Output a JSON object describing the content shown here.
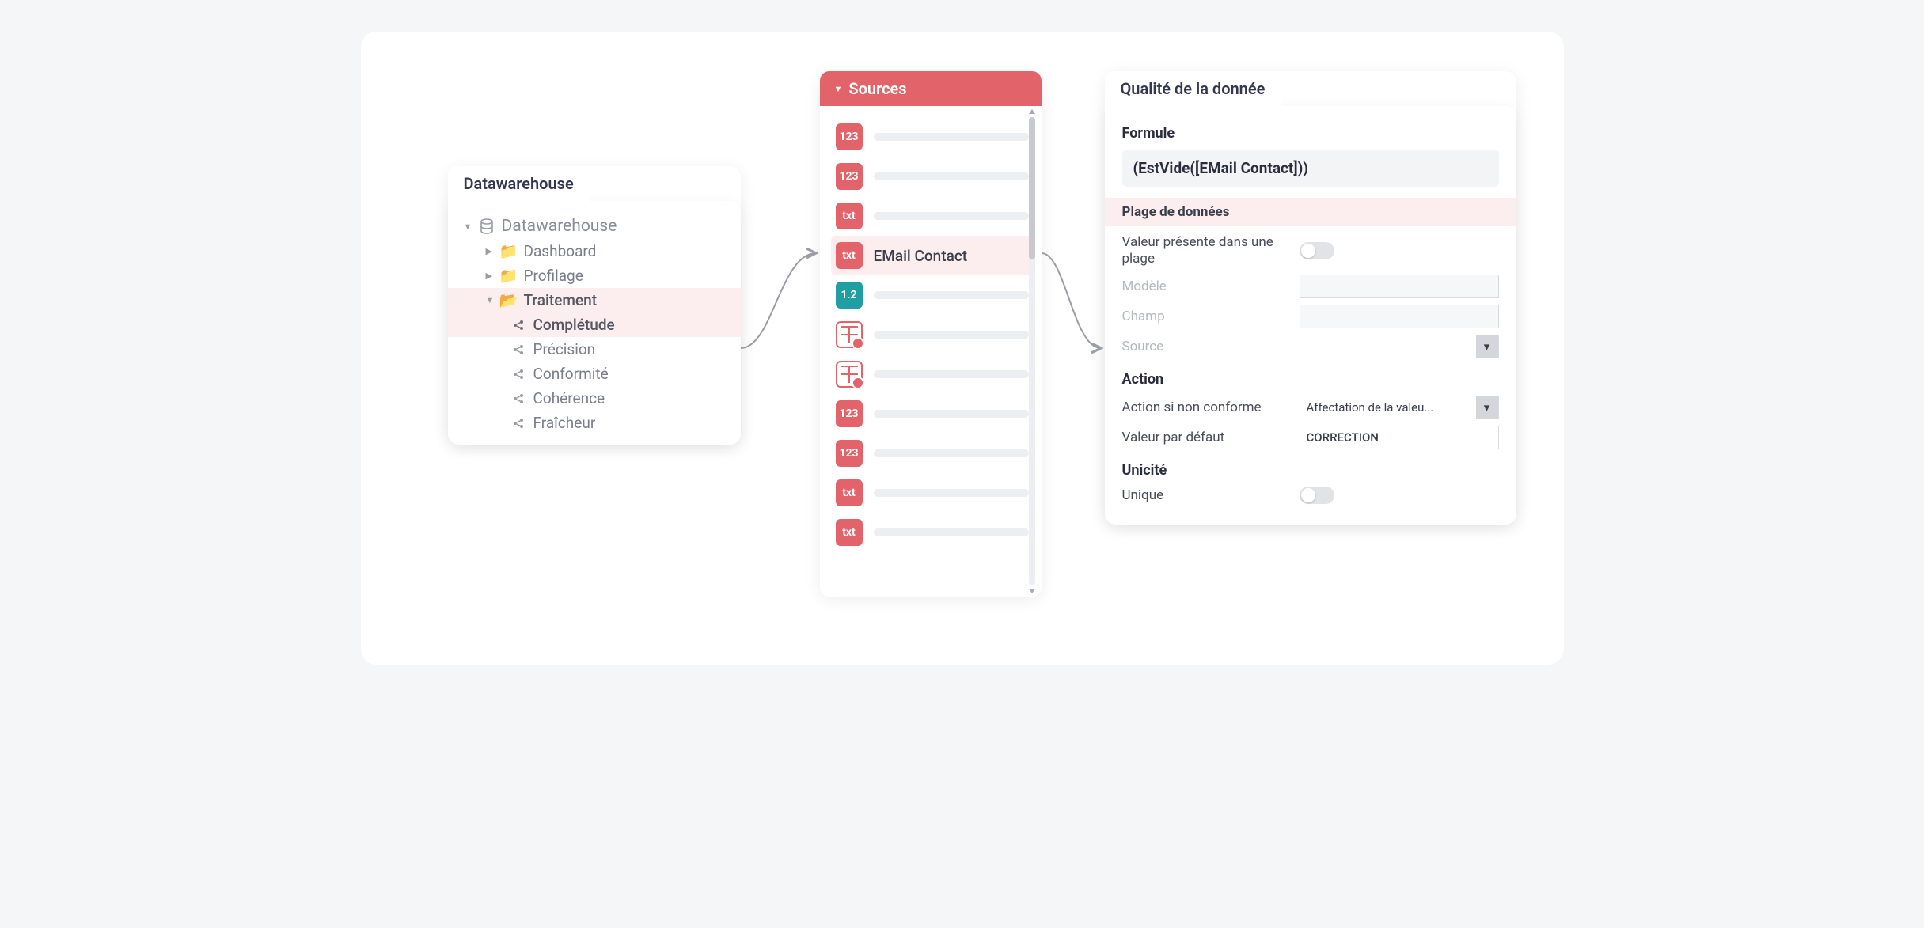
{
  "panel1": {
    "title": "Datawarehouse",
    "root": "Datawarehouse",
    "items": {
      "dashboard": "Dashboard",
      "profilage": "Profilage",
      "traitement": "Traitement",
      "completude": "Complétude",
      "precision": "Précision",
      "conformite": "Conformité",
      "coherence": "Cohérence",
      "fraicheur": "Fraîcheur"
    }
  },
  "panel2": {
    "title": "Sources",
    "rows": [
      {
        "badge": "123",
        "kind": "red"
      },
      {
        "badge": "123",
        "kind": "red"
      },
      {
        "badge": "txt",
        "kind": "red"
      },
      {
        "badge": "txt",
        "kind": "red",
        "label": "EMail Contact",
        "selected": true
      },
      {
        "badge": "1.2",
        "kind": "teal"
      },
      {
        "badge": "",
        "kind": "date"
      },
      {
        "badge": "",
        "kind": "date"
      },
      {
        "badge": "123",
        "kind": "red"
      },
      {
        "badge": "123",
        "kind": "red"
      },
      {
        "badge": "txt",
        "kind": "red"
      },
      {
        "badge": "txt",
        "kind": "red"
      }
    ]
  },
  "panel3": {
    "title": "Qualité de la donnée",
    "formule_label": "Formule",
    "formule": "(EstVide([EMail Contact]))",
    "plage_label": "Plage de données",
    "valeur_presente": "Valeur présente dans une plage",
    "modele": "Modèle",
    "champ": "Champ",
    "source": "Source",
    "action_label": "Action",
    "action_si": "Action si non conforme",
    "action_val": "Affectation de la valeu...",
    "valeur_def_label": "Valeur par défaut",
    "valeur_def": "CORRECTION",
    "unicite_label": "Unicité",
    "unique": "Unique"
  }
}
